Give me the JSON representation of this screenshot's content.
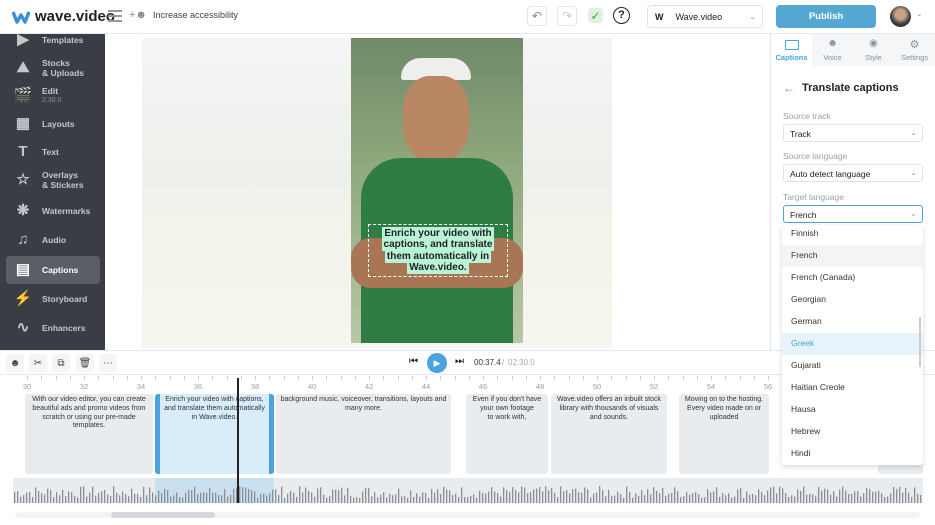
{
  "header": {
    "brand": "wave.video",
    "accessibility": "Increase accessibility",
    "workspace_initial": "W",
    "workspace": "Wave.video",
    "publish": "Publish"
  },
  "sidebar": [
    {
      "label": "Templates",
      "icon": "templates-icon"
    },
    {
      "label": "Stocks\n& Uploads",
      "icon": "image-icon"
    },
    {
      "label": "Edit",
      "sub": "2:30.0",
      "icon": "clapperboard-icon"
    },
    {
      "label": "Layouts",
      "icon": "layouts-icon"
    },
    {
      "label": "Text",
      "icon": "text-icon"
    },
    {
      "label": "Overlays\n& Stickers",
      "icon": "star-icon"
    },
    {
      "label": "Watermarks",
      "icon": "watermark-icon"
    },
    {
      "label": "Audio",
      "icon": "music-icon"
    },
    {
      "label": "Captions",
      "icon": "captions-icon",
      "active": true
    },
    {
      "label": "Storyboard",
      "icon": "storyboard-icon"
    },
    {
      "label": "Enhancers",
      "icon": "waveform-icon"
    }
  ],
  "video": {
    "caption": "Enrich your video with captions, and translate them automatically in Wave.video."
  },
  "panel": {
    "tabs": [
      "Captions",
      "Voice",
      "Style",
      "Settings"
    ],
    "title": "Translate captions",
    "source_track_label": "Source track",
    "source_track": "Track",
    "source_language_label": "Source language",
    "source_language": "Auto detect language",
    "target_language_label": "Target language",
    "target_language": "French",
    "options": [
      "Finnish",
      "French",
      "French (Canada)",
      "Georgian",
      "German",
      "Greek",
      "Gujarati",
      "Haitian Creole",
      "Hausa",
      "Hebrew",
      "Hindi"
    ],
    "selected_option": "French",
    "hovered_option": "Greek"
  },
  "timeline": {
    "current_time": "00:37.4",
    "total_time": "02:30.0",
    "ticks": [
      "30",
      "32",
      "34",
      "36",
      "38",
      "40",
      "42",
      "44",
      "46",
      "48",
      "50",
      "52",
      "54",
      "56"
    ],
    "clips": [
      {
        "text": "With our video editor, you can create beautiful ads and promo videos from scratch or using our pre-made templates."
      },
      {
        "text": "Enrich your video with captions, and translate them automatically in Wave.video.",
        "selected": true
      },
      {
        "text": "background music, voiceover, transitions, layouts and many more."
      },
      {
        "text": "Even if you don't have your own footage\nto work with,"
      },
      {
        "text": "Wave.video offers an inbuilt stock library with thousands of visuals and sounds."
      },
      {
        "text": "Moving on to the hosting.\nEvery video made on or uploaded"
      }
    ]
  },
  "colors": {
    "accent": "#4aa3dc",
    "sidebar": "#3a3d44",
    "publish": "#55a8d2"
  }
}
